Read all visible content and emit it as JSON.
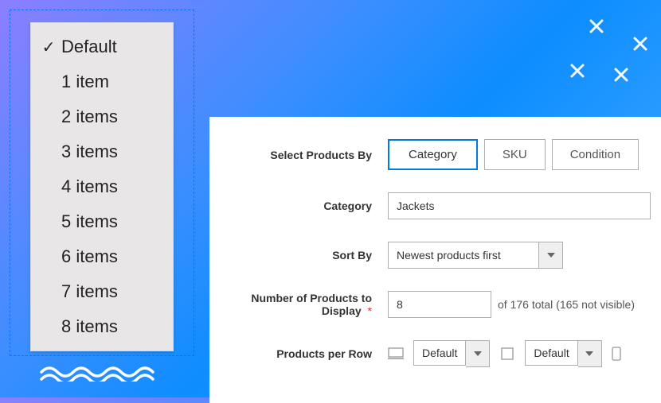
{
  "dropdown": {
    "items": [
      {
        "label": "Default",
        "selected": true
      },
      {
        "label": "1 item"
      },
      {
        "label": "2 items"
      },
      {
        "label": "3 items"
      },
      {
        "label": "4 items"
      },
      {
        "label": "5 items"
      },
      {
        "label": "6 items"
      },
      {
        "label": "7 items"
      },
      {
        "label": "8 items"
      }
    ]
  },
  "form": {
    "select_products_by": {
      "label": "Select Products By",
      "options": {
        "category": "Category",
        "sku": "SKU",
        "condition": "Condition"
      },
      "active": "category"
    },
    "category": {
      "label": "Category",
      "value": "Jackets"
    },
    "sort_by": {
      "label": "Sort By",
      "value": "Newest products first"
    },
    "num_products": {
      "label": "Number of Products to Display",
      "value": "8",
      "hint": "of 176 total (165 not visible)"
    },
    "products_per_row": {
      "label": "Products per Row",
      "desktop": "Default",
      "tablet": "Default"
    }
  }
}
